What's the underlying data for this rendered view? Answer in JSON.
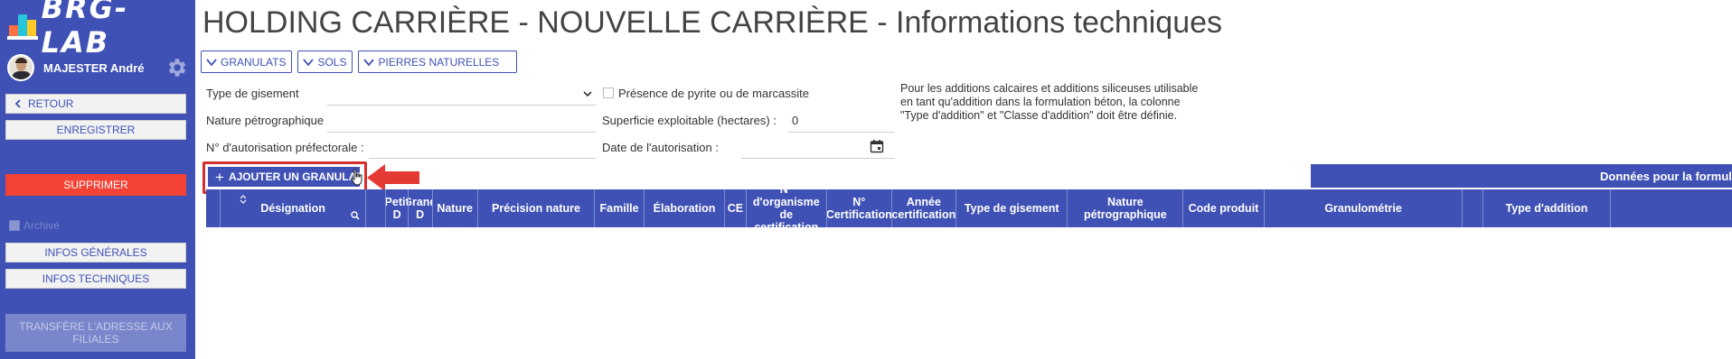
{
  "app": {
    "logo_text": "BRG-LAB"
  },
  "user": {
    "name": "MAJESTER André"
  },
  "sidebar": {
    "back_label": "RETOUR",
    "save_label": "ENREGISTRER",
    "delete_label": "SUPPRIMER",
    "archive_label": "Archivé",
    "general_info_label": "INFOS GÉNÉRALES",
    "technical_info_label": "INFOS TECHNIQUES",
    "transfer_label": "TRANSFÈRE L'ADRESSE AUX FILIALES"
  },
  "page": {
    "title": "HOLDING CARRIÈRE - NOUVELLE CARRIÈRE - Informations techniques"
  },
  "tabs": [
    {
      "label": "GRANULATS"
    },
    {
      "label": "SOLS"
    },
    {
      "label": "PIERRES NATURELLES"
    }
  ],
  "form": {
    "deposit_type_label": "Type de gisement",
    "deposit_type_value": "",
    "petro_nature_label": "Nature pétrographique",
    "petro_nature_value": "",
    "prefectoral_auth_label": "N° d'autorisation préfectorale :",
    "prefectoral_auth_value": "",
    "pyrite_label": "Présence de pyrite ou de marcassite",
    "pyrite_checked": false,
    "area_label": "Superficie exploitable (hectares) :",
    "area_value": "0",
    "auth_date_label": "Date de l'autorisation :",
    "auth_date_value": "",
    "note": "Pour les additions calcaires et additions siliceuses utilisable en tant qu'addition dans la formulation béton, la colonne \"Type d'addition\" et \"Classe d'addition\" doit être définie."
  },
  "actions": {
    "add_aggregate_label": "AJOUTER UN GRANULAT"
  },
  "grid": {
    "group_header": "Données pour la formulation",
    "columns": [
      {
        "label": ""
      },
      {
        "label": "Désignation"
      },
      {
        "label": ""
      },
      {
        "label": "Petit D"
      },
      {
        "label": "Grand D"
      },
      {
        "label": "Nature"
      },
      {
        "label": "Précision nature"
      },
      {
        "label": "Famille"
      },
      {
        "label": "Élaboration"
      },
      {
        "label": "CE"
      },
      {
        "label": "N° d'organisme de certification"
      },
      {
        "label": "N° Certification"
      },
      {
        "label": "Année certification"
      },
      {
        "label": "Type de gisement"
      },
      {
        "label": "Nature pétrographique"
      },
      {
        "label": "Code produit"
      },
      {
        "label": "Granulométrie"
      },
      {
        "label": ""
      },
      {
        "label": "Type d'addition"
      },
      {
        "label": ""
      }
    ],
    "rows": []
  },
  "colors": {
    "primary": "#3f51b5",
    "danger": "#f44336",
    "highlight": "#d32f2f"
  }
}
